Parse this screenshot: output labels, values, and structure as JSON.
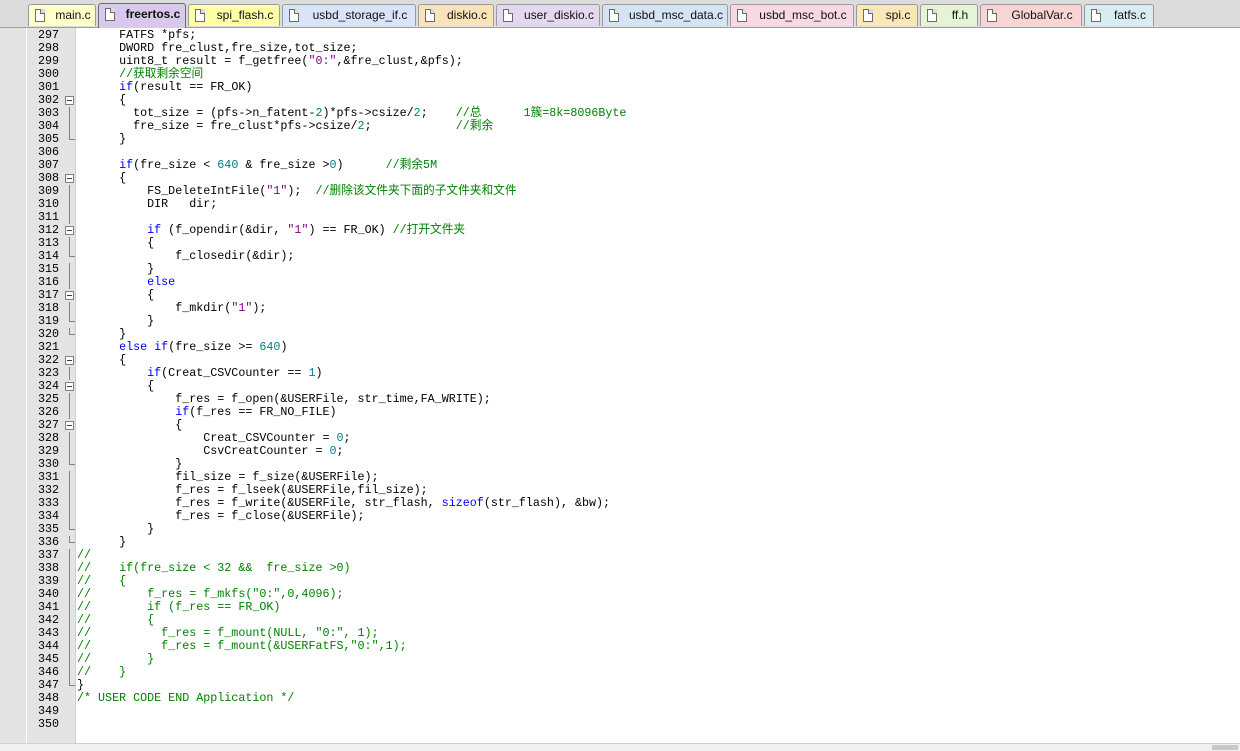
{
  "tabs": [
    {
      "label": "main.c",
      "color": "#ffffc8"
    },
    {
      "label": "freertos.c",
      "color": "#d8c8ec",
      "active": true
    },
    {
      "label": "spi_flash.c",
      "color": "#ffffa8"
    },
    {
      "label": "usbd_storage_if.c",
      "color": "#d8e4f8"
    },
    {
      "label": "diskio.c",
      "color": "#f8e4b8"
    },
    {
      "label": "user_diskio.c",
      "color": "#e4d8f0"
    },
    {
      "label": "usbd_msc_data.c",
      "color": "#d4e4f4"
    },
    {
      "label": "usbd_msc_bot.c",
      "color": "#f8d8e4"
    },
    {
      "label": "spi.c",
      "color": "#f8e8b8"
    },
    {
      "label": "ff.h",
      "color": "#e4f4d4"
    },
    {
      "label": "GlobalVar.c",
      "color": "#f8d4d4"
    },
    {
      "label": "fatfs.c",
      "color": "#d8ecf4"
    }
  ],
  "editor": {
    "lines": [
      {
        "n": "297",
        "segs": [
          [
            "      FATFS *pfs;",
            ""
          ]
        ]
      },
      {
        "n": "298",
        "segs": [
          [
            "      DWORD fre_clust,fre_size,tot_size;",
            ""
          ]
        ]
      },
      {
        "n": "299",
        "segs": [
          [
            "      uint8_t result = f_getfree(",
            ""
          ],
          [
            "\"0:\"",
            "str"
          ],
          [
            ",&fre_clust,&pfs);",
            ""
          ]
        ]
      },
      {
        "n": "300",
        "segs": [
          [
            "      //获取剩余空间",
            "cmt"
          ]
        ]
      },
      {
        "n": "301",
        "segs": [
          [
            "      ",
            ""
          ],
          [
            "if",
            "kw"
          ],
          [
            "(result == FR_OK)",
            ""
          ]
        ]
      },
      {
        "n": "302",
        "segs": [
          [
            "      {",
            ""
          ]
        ]
      },
      {
        "n": "303",
        "segs": [
          [
            "        tot_size = (pfs->n_fatent-",
            ""
          ],
          [
            "2",
            "num"
          ],
          [
            ")*pfs->csize/",
            ""
          ],
          [
            "2",
            "num"
          ],
          [
            ";    ",
            ""
          ],
          [
            "//总      1簇=8k=8096Byte",
            "cmt"
          ]
        ]
      },
      {
        "n": "304",
        "segs": [
          [
            "        fre_size = fre_clust*pfs->csize/",
            ""
          ],
          [
            "2",
            "num"
          ],
          [
            ";            ",
            ""
          ],
          [
            "//剩余",
            "cmt"
          ]
        ]
      },
      {
        "n": "305",
        "segs": [
          [
            "      }",
            ""
          ]
        ]
      },
      {
        "n": "306",
        "segs": [
          [
            "",
            ""
          ]
        ]
      },
      {
        "n": "307",
        "segs": [
          [
            "      ",
            ""
          ],
          [
            "if",
            "kw"
          ],
          [
            "(fre_size < ",
            ""
          ],
          [
            "640",
            "num"
          ],
          [
            " & fre_size >",
            ""
          ],
          [
            "0",
            "num"
          ],
          [
            ")      ",
            ""
          ],
          [
            "//剩余5M",
            "cmt"
          ]
        ]
      },
      {
        "n": "308",
        "segs": [
          [
            "      {",
            ""
          ]
        ]
      },
      {
        "n": "309",
        "segs": [
          [
            "          FS_DeleteIntFile(",
            ""
          ],
          [
            "\"1\"",
            "str"
          ],
          [
            ");  ",
            ""
          ],
          [
            "//删除该文件夹下面的子文件夹和文件",
            "cmt"
          ]
        ]
      },
      {
        "n": "310",
        "segs": [
          [
            "          DIR   dir;",
            ""
          ]
        ]
      },
      {
        "n": "311",
        "segs": [
          [
            "",
            ""
          ]
        ]
      },
      {
        "n": "312",
        "segs": [
          [
            "          ",
            ""
          ],
          [
            "if",
            "kw"
          ],
          [
            " (f_opendir(&dir, ",
            ""
          ],
          [
            "\"1\"",
            "str"
          ],
          [
            ") == FR_OK) ",
            ""
          ],
          [
            "//打开文件夹",
            "cmt"
          ]
        ]
      },
      {
        "n": "313",
        "segs": [
          [
            "          {",
            ""
          ]
        ]
      },
      {
        "n": "314",
        "segs": [
          [
            "              f_closedir(&dir);",
            ""
          ]
        ]
      },
      {
        "n": "315",
        "segs": [
          [
            "          }",
            ""
          ]
        ]
      },
      {
        "n": "316",
        "segs": [
          [
            "          ",
            ""
          ],
          [
            "else",
            "kw"
          ]
        ]
      },
      {
        "n": "317",
        "segs": [
          [
            "          {",
            ""
          ]
        ]
      },
      {
        "n": "318",
        "segs": [
          [
            "              f_mkdir(",
            ""
          ],
          [
            "\"1\"",
            "str"
          ],
          [
            ");",
            ""
          ]
        ]
      },
      {
        "n": "319",
        "segs": [
          [
            "          }",
            ""
          ]
        ]
      },
      {
        "n": "320",
        "segs": [
          [
            "      }",
            ""
          ]
        ]
      },
      {
        "n": "321",
        "segs": [
          [
            "      ",
            ""
          ],
          [
            "else if",
            "kw"
          ],
          [
            "(fre_size >= ",
            ""
          ],
          [
            "640",
            "num"
          ],
          [
            ")",
            ""
          ]
        ]
      },
      {
        "n": "322",
        "segs": [
          [
            "      {",
            ""
          ]
        ]
      },
      {
        "n": "323",
        "segs": [
          [
            "          ",
            ""
          ],
          [
            "if",
            "kw"
          ],
          [
            "(Creat_CSVCounter == ",
            ""
          ],
          [
            "1",
            "num"
          ],
          [
            ")",
            ""
          ]
        ]
      },
      {
        "n": "324",
        "segs": [
          [
            "          {",
            ""
          ]
        ]
      },
      {
        "n": "325",
        "segs": [
          [
            "              f_res = f_open(&USERFile, str_time,FA_WRITE);",
            ""
          ]
        ]
      },
      {
        "n": "326",
        "segs": [
          [
            "              ",
            ""
          ],
          [
            "if",
            "kw"
          ],
          [
            "(f_res == FR_NO_FILE)",
            ""
          ]
        ]
      },
      {
        "n": "327",
        "segs": [
          [
            "              {",
            ""
          ]
        ]
      },
      {
        "n": "328",
        "segs": [
          [
            "                  Creat_CSVCounter = ",
            ""
          ],
          [
            "0",
            "num"
          ],
          [
            ";",
            ""
          ]
        ]
      },
      {
        "n": "329",
        "segs": [
          [
            "                  CsvCreatCounter = ",
            ""
          ],
          [
            "0",
            "num"
          ],
          [
            ";",
            ""
          ]
        ]
      },
      {
        "n": "330",
        "segs": [
          [
            "              }",
            ""
          ]
        ]
      },
      {
        "n": "331",
        "segs": [
          [
            "              fil_size = f_size(&USERFile);",
            ""
          ]
        ]
      },
      {
        "n": "332",
        "segs": [
          [
            "              f_res = f_lseek(&USERFile,fil_size);",
            ""
          ]
        ]
      },
      {
        "n": "333",
        "segs": [
          [
            "              f_res = f_write(&USERFile, str_flash, ",
            ""
          ],
          [
            "sizeof",
            "kw"
          ],
          [
            "(str_flash), &bw);",
            ""
          ]
        ]
      },
      {
        "n": "334",
        "segs": [
          [
            "              f_res = f_close(&USERFile);",
            ""
          ]
        ]
      },
      {
        "n": "335",
        "segs": [
          [
            "          }",
            ""
          ]
        ]
      },
      {
        "n": "336",
        "segs": [
          [
            "      }",
            ""
          ]
        ]
      },
      {
        "n": "337",
        "segs": [
          [
            "//",
            "cmt"
          ]
        ]
      },
      {
        "n": "338",
        "segs": [
          [
            "//    if(fre_size < 32 &&  fre_size >0)",
            "cmt"
          ]
        ]
      },
      {
        "n": "339",
        "segs": [
          [
            "//    {",
            "cmt"
          ]
        ]
      },
      {
        "n": "340",
        "segs": [
          [
            "//        f_res = f_mkfs(\"0:\",0,4096);",
            "cmt"
          ]
        ]
      },
      {
        "n": "341",
        "segs": [
          [
            "//        if (f_res == FR_OK)",
            "cmt"
          ]
        ]
      },
      {
        "n": "342",
        "segs": [
          [
            "//        {",
            "cmt"
          ]
        ]
      },
      {
        "n": "343",
        "segs": [
          [
            "//          f_res = f_mount(NULL, \"0:\", 1);",
            "cmt"
          ]
        ]
      },
      {
        "n": "344",
        "segs": [
          [
            "//          f_res = f_mount(&USERFatFS,\"0:\",1);",
            "cmt"
          ]
        ]
      },
      {
        "n": "345",
        "segs": [
          [
            "//        }",
            "cmt"
          ]
        ]
      },
      {
        "n": "346",
        "segs": [
          [
            "//    }",
            "cmt"
          ]
        ]
      },
      {
        "n": "347",
        "segs": [
          [
            "}",
            ""
          ]
        ]
      },
      {
        "n": "348",
        "segs": [
          [
            "/* USER CODE END Application */",
            "cmt"
          ]
        ]
      },
      {
        "n": "349",
        "segs": [
          [
            "",
            ""
          ]
        ]
      },
      {
        "n": "350",
        "segs": [
          [
            "",
            ""
          ]
        ]
      }
    ]
  }
}
